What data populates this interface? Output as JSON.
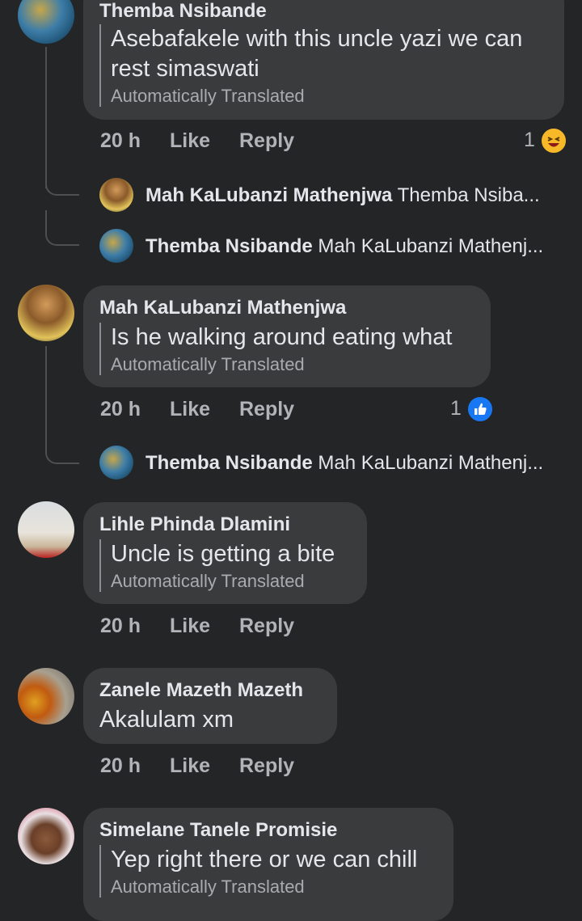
{
  "comments": [
    {
      "author": "Themba Nsibande",
      "text": "Asebafakele with this uncle yazi we can rest simaswati",
      "translated": "Automatically Translated",
      "time": "20 h",
      "like": "Like",
      "reply": "Reply",
      "reaction_count": "1",
      "reaction_icon": "haha-emoji-icon",
      "replies": [
        {
          "author": "Mah KaLubanzi Mathenjwa",
          "text": "Themba Nsiba..."
        },
        {
          "author": "Themba Nsibande",
          "text": "Mah KaLubanzi Mathenj..."
        }
      ]
    },
    {
      "author": "Mah KaLubanzi Mathenjwa",
      "text": "Is he walking around eating what",
      "translated": "Automatically Translated",
      "time": "20 h",
      "like": "Like",
      "reply": "Reply",
      "reaction_count": "1",
      "reaction_icon": "like-thumb-icon",
      "replies": [
        {
          "author": "Themba Nsibande",
          "text": "Mah KaLubanzi Mathenj..."
        }
      ]
    },
    {
      "author": "Lihle Phinda Dlamini",
      "text": "Uncle is getting a bite",
      "translated": "Automatically Translated",
      "time": "20 h",
      "like": "Like",
      "reply": "Reply"
    },
    {
      "author": "Zanele Mazeth Mazeth",
      "text": "Akalulam xm",
      "time": "20 h",
      "like": "Like",
      "reply": "Reply"
    },
    {
      "author": "Simelane Tanele Promisie",
      "text": "Yep right there or we can chill",
      "translated": "Automatically Translated"
    }
  ],
  "colors": {
    "background": "#242526",
    "bubble": "#3a3b3c",
    "like_blue": "#1877f2",
    "haha_yellow": "#f7b928"
  }
}
